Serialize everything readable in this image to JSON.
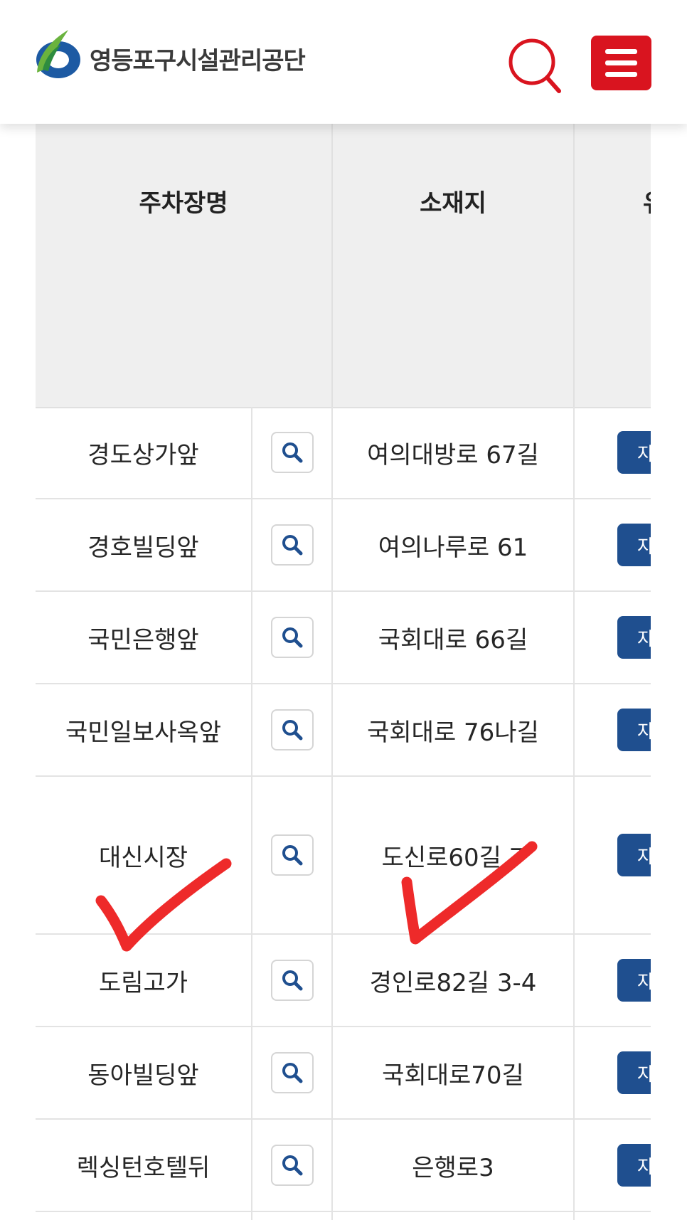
{
  "header": {
    "org_name": "영등포구시설관리공단",
    "search_icon": "search-icon",
    "menu_icon": "hamburger-menu-icon",
    "colors": {
      "menu_bg": "#d9141f",
      "search_stroke": "#d9141f"
    }
  },
  "table": {
    "headers": {
      "name": "주차장명",
      "location": "소재지",
      "use": "유"
    },
    "action_label": "자",
    "rows": [
      {
        "name": "경도상가앞",
        "location": "여의대방로 67길"
      },
      {
        "name": "경호빌딩앞",
        "location": "여의나루로 61"
      },
      {
        "name": "국민은행앞",
        "location": "국회대로 66길"
      },
      {
        "name": "국민일보사옥앞",
        "location": "국회대로 76나길"
      },
      {
        "name": "대신시장",
        "location": "도신로60길 7"
      },
      {
        "name": "도림고가",
        "location": "경인로82길 3-4"
      },
      {
        "name": "동아빌딩앞",
        "location": "국회대로70길"
      },
      {
        "name": "렉싱턴호텔뒤",
        "location": "은행로3"
      }
    ],
    "colors": {
      "action_bg": "#1f4f8f",
      "header_bg": "#efefef"
    }
  },
  "annotations": {
    "checkmark_color": "#ee2a2a"
  }
}
